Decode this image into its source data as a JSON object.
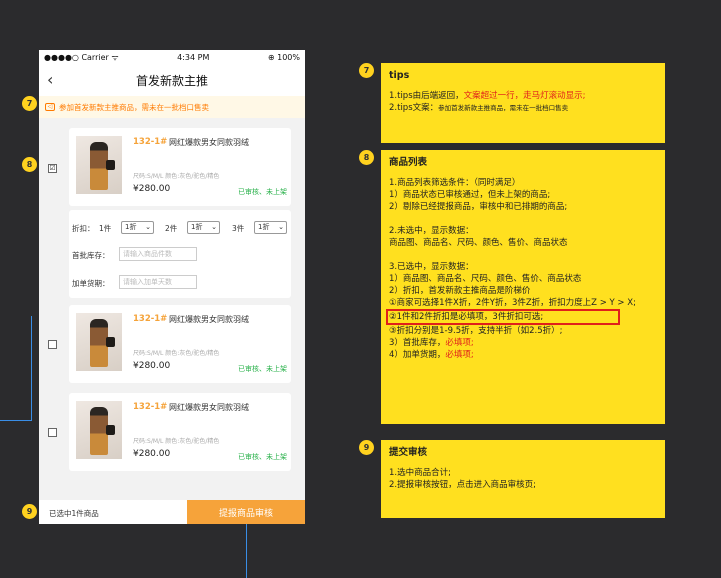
{
  "status_bar": {
    "carrier": "●●●●○ Carrier ᯤ",
    "time": "4:34 PM",
    "battery": "⊕ 100%"
  },
  "nav": {
    "title": "首发新款主推",
    "back_icon": "chevron-left-icon"
  },
  "tip": "参加首发新款主推商品，需未在一批档口售卖",
  "products": [
    {
      "code": "132-1#",
      "name": "网红爆款男女同款羽绒",
      "spec": "尺码:S/M/L   颜色:灰色/驼色/精色",
      "price": "¥280.00",
      "status": "已审核、未上架",
      "checked": "☑"
    },
    {
      "code": "132-1#",
      "name": "网红爆款男女同款羽绒",
      "spec": "尺码:S/M/L   颜色:灰色/驼色/精色",
      "price": "¥280.00",
      "status": "已审核、未上架",
      "checked": ""
    },
    {
      "code": "132-1#",
      "name": "网红爆款男女同款羽绒",
      "spec": "尺码:S/M/L   颜色:灰色/驼色/精色",
      "price": "¥280.00",
      "status": "已审核、未上架",
      "checked": ""
    }
  ],
  "discount": {
    "label": "折扣：",
    "items": [
      {
        "qty": "1件",
        "value": "1折"
      },
      {
        "qty": "2件",
        "value": "1折"
      },
      {
        "qty": "3件",
        "value": "1折"
      }
    ],
    "stock_label": "首批库存：",
    "stock_placeholder": "请输入商品件数",
    "days_label": "加单货期：",
    "days_placeholder": "请输入加单天数"
  },
  "bottom": {
    "selected_text": "已选中1件商品",
    "submit_label": "提报商品审核"
  },
  "badges": {
    "b7": "7",
    "b8": "8",
    "b9": "9"
  },
  "notes": {
    "n7": {
      "title": "tips",
      "l1a": "1.tips由后端返回，",
      "l1b": "文案超过一行，走马灯滚动显示;",
      "l2a": "2.tips文案：",
      "l2b": "参加首发新款主推商品，需未在一批档口售卖"
    },
    "n8": {
      "title": "商品列表",
      "p1": "1.商品列表筛选条件：（同时满足）\n1）商品状态已审核通过，但未上架的商品;\n2）剔除已经提报商品，审核中和已排期的商品;",
      "p2": "2.未选中，显示数据：\n商品图、商品名、尺码、颜色、售价、商品状态",
      "p3": "3.已选中，显示数据：\n1）商品图、商品名、尺码、颜色、售价、商品状态\n2）折扣，首发新款主推商品是阶梯价\n①商家可选择1件X折，2件Y折，3件Z折，折扣力度上Z > Y > X;",
      "hl": "②1件和2件折扣是必填项，3件折扣可选;",
      "p4a": "③折扣分别是1-9.5折，支持半折（如2.5折）;",
      "p4b": "3）首批库存，",
      "p4b_red": "必填项;",
      "p4c": "4）加单货期，",
      "p4c_red": "必填项;"
    },
    "n9": {
      "title": "提交审核",
      "body": "1.选中商品合计;\n2.提报审核按钮，点击进入商品审核页;"
    }
  },
  "colors": {
    "accent": "#f6a33a",
    "note_bg": "#ffe01f",
    "red": "#e0201b",
    "green": "#2bb24c"
  }
}
